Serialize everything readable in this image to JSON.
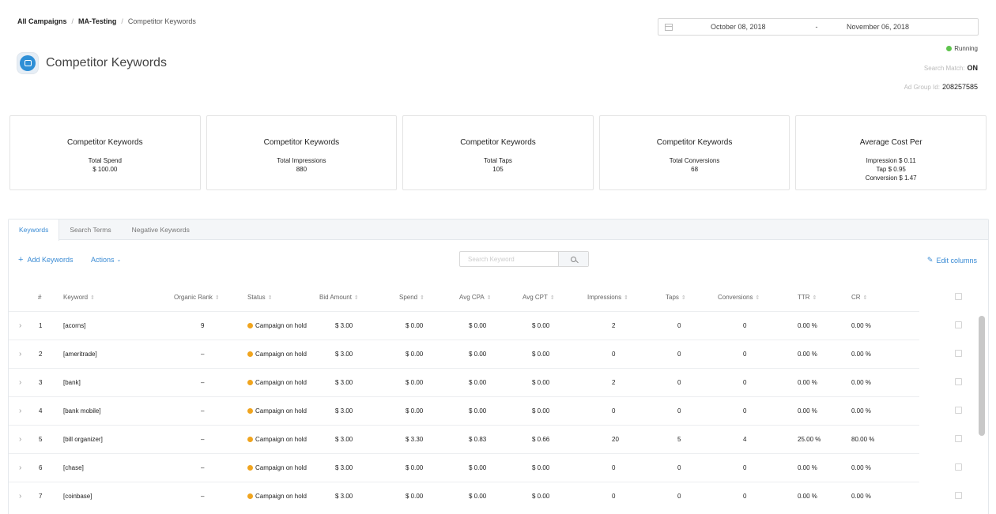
{
  "breadcrumb": {
    "items": [
      "All Campaigns",
      "MA-Testing",
      "Competitor Keywords"
    ],
    "separator": "/"
  },
  "date_range": {
    "from": "October 08, 2018",
    "separator": "-",
    "to": "November 06, 2018"
  },
  "status": {
    "label": "Running",
    "color": "#5ec44d"
  },
  "search_match": {
    "label": "Search Match:",
    "value": "ON"
  },
  "ad_group": {
    "label": "Ad Group Id:",
    "value": "208257585"
  },
  "page": {
    "title": "Competitor Keywords",
    "icon": "app-icon"
  },
  "summary_cards": [
    {
      "title": "Competitor Keywords",
      "lines": [
        "Total Spend",
        "$ 100.00"
      ]
    },
    {
      "title": "Competitor Keywords",
      "lines": [
        "Total Impressions",
        "880"
      ]
    },
    {
      "title": "Competitor Keywords",
      "lines": [
        "Total Taps",
        "105"
      ]
    },
    {
      "title": "Competitor Keywords",
      "lines": [
        "Total Conversions",
        "68"
      ]
    },
    {
      "title": "Average Cost Per",
      "lines": [
        "Impression $ 0.11",
        "Tap $ 0.95",
        "Conversion $ 1.47"
      ]
    }
  ],
  "tabs": [
    {
      "label": "Keywords",
      "active": true
    },
    {
      "label": "Search Terms",
      "active": false
    },
    {
      "label": "Negative Keywords",
      "active": false
    }
  ],
  "toolbar": {
    "add_label": "Add Keywords",
    "actions_label": "Actions",
    "search_placeholder": "Search Keyword",
    "edit_columns_label": "Edit columns"
  },
  "accent_color": "#3a8bd4",
  "table": {
    "columns": [
      "#",
      "Keyword",
      "Organic Rank",
      "Status",
      "Bid Amount",
      "Spend",
      "Avg CPA",
      "Avg CPT",
      "Impressions",
      "Taps",
      "Conversions",
      "TTR",
      "CR"
    ],
    "rows": [
      [
        "1",
        "[acorns]",
        "9",
        "Campaign on hold",
        "$ 3.00",
        "$ 0.00",
        "$ 0.00",
        "$ 0.00",
        "2",
        "0",
        "0",
        "0.00 %",
        "0.00 %"
      ],
      [
        "2",
        "[ameritrade]",
        "–",
        "Campaign on hold",
        "$ 3.00",
        "$ 0.00",
        "$ 0.00",
        "$ 0.00",
        "0",
        "0",
        "0",
        "0.00 %",
        "0.00 %"
      ],
      [
        "3",
        "[bank]",
        "–",
        "Campaign on hold",
        "$ 3.00",
        "$ 0.00",
        "$ 0.00",
        "$ 0.00",
        "2",
        "0",
        "0",
        "0.00 %",
        "0.00 %"
      ],
      [
        "4",
        "[bank mobile]",
        "–",
        "Campaign on hold",
        "$ 3.00",
        "$ 0.00",
        "$ 0.00",
        "$ 0.00",
        "0",
        "0",
        "0",
        "0.00 %",
        "0.00 %"
      ],
      [
        "5",
        "[bill organizer]",
        "–",
        "Campaign on hold",
        "$ 3.00",
        "$ 3.30",
        "$ 0.83",
        "$ 0.66",
        "20",
        "5",
        "4",
        "25.00 %",
        "80.00 %"
      ],
      [
        "6",
        "[chase]",
        "–",
        "Campaign on hold",
        "$ 3.00",
        "$ 0.00",
        "$ 0.00",
        "$ 0.00",
        "0",
        "0",
        "0",
        "0.00 %",
        "0.00 %"
      ],
      [
        "7",
        "[coinbase]",
        "–",
        "Campaign on hold",
        "$ 3.00",
        "$ 0.00",
        "$ 0.00",
        "$ 0.00",
        "0",
        "0",
        "0",
        "0.00 %",
        "0.00 %"
      ]
    ],
    "status_color": "#f0a41e"
  }
}
